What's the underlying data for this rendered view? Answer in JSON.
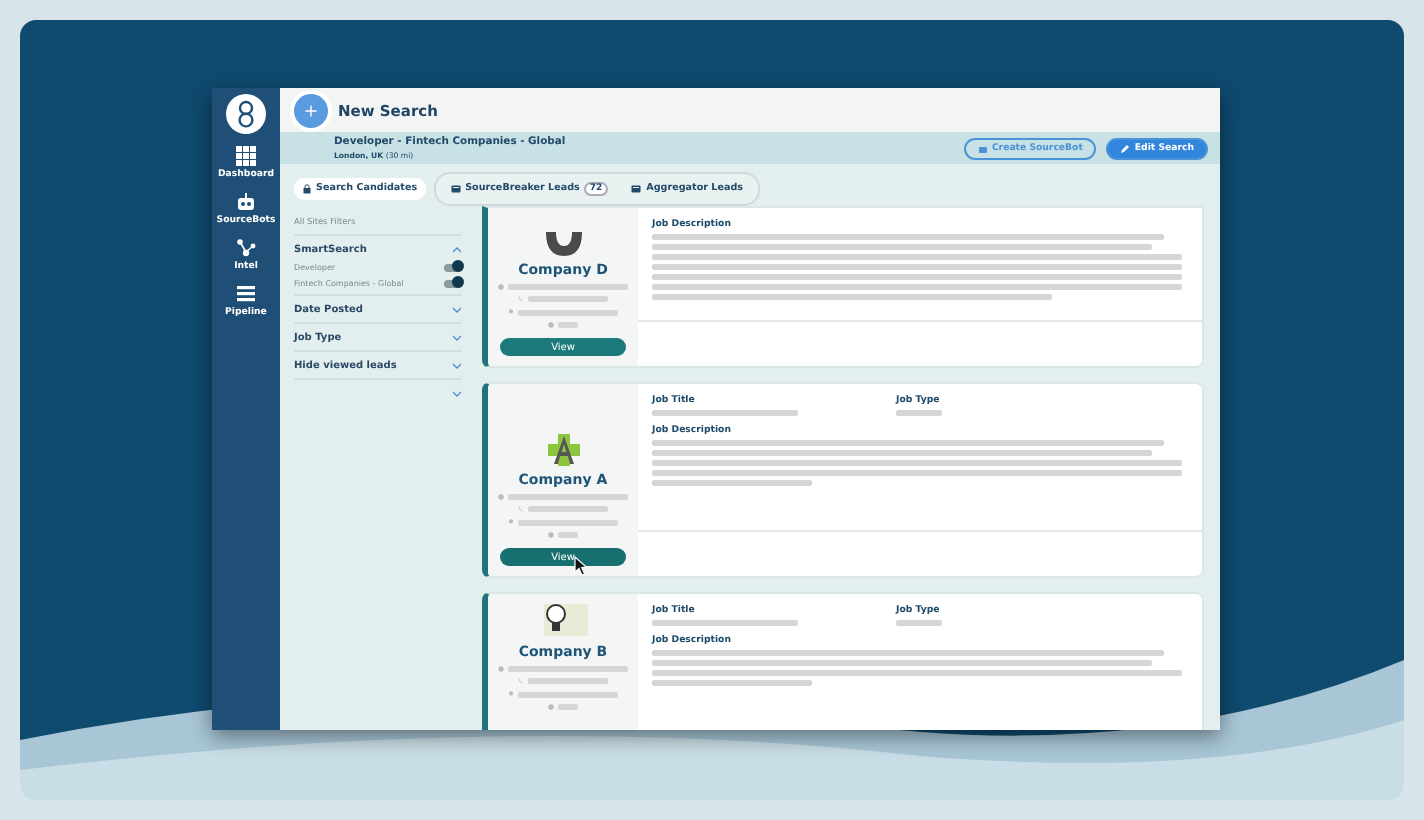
{
  "sidebar": {
    "items": [
      {
        "label": "Dashboard"
      },
      {
        "label": "SourceBots"
      },
      {
        "label": "Intel"
      },
      {
        "label": "Pipeline"
      }
    ]
  },
  "header": {
    "title": "New Search"
  },
  "search": {
    "title": "Developer - Fintech Companies - Global",
    "location": "London, UK",
    "radius": "(30 mi)",
    "buttons": [
      {
        "label": "Create SourceBot",
        "kind": "outline"
      },
      {
        "label": "Edit Search",
        "kind": "solid"
      }
    ]
  },
  "tabs": [
    {
      "label": "Search Candidates"
    },
    {
      "label": "SourceBreaker Leads",
      "count": "72"
    },
    {
      "label": "Aggregator Leads"
    }
  ],
  "filters": {
    "title": "All Sites Filters",
    "sections": [
      {
        "label": "SmartSearch",
        "expanded": true,
        "toggles": [
          {
            "label": "Developer",
            "on": true
          },
          {
            "label": "Fintech Companies - Global",
            "on": true
          }
        ]
      },
      {
        "label": "Date Posted",
        "expanded": false
      },
      {
        "label": "Job Type",
        "expanded": false
      },
      {
        "label": "Hide viewed leads",
        "expanded": false
      },
      {
        "expanded": false
      }
    ]
  },
  "cards": [
    {
      "company": "Company D",
      "button": "View",
      "hovered": false,
      "fields": [
        {
          "label": "Job Description",
          "kind": "description"
        }
      ]
    },
    {
      "company": "Company A",
      "button": "View",
      "hovered": true,
      "fields": [
        {
          "label": "Job Title",
          "kind": "short"
        },
        {
          "label": "Job Type",
          "kind": "tiny"
        },
        {
          "label": "Job Description",
          "kind": "description"
        }
      ]
    },
    {
      "company": "Company B",
      "fields": [
        {
          "label": "Job Title",
          "kind": "short"
        },
        {
          "label": "Job Type",
          "kind": "tiny"
        },
        {
          "label": "Job Description",
          "kind": "description"
        }
      ]
    }
  ]
}
